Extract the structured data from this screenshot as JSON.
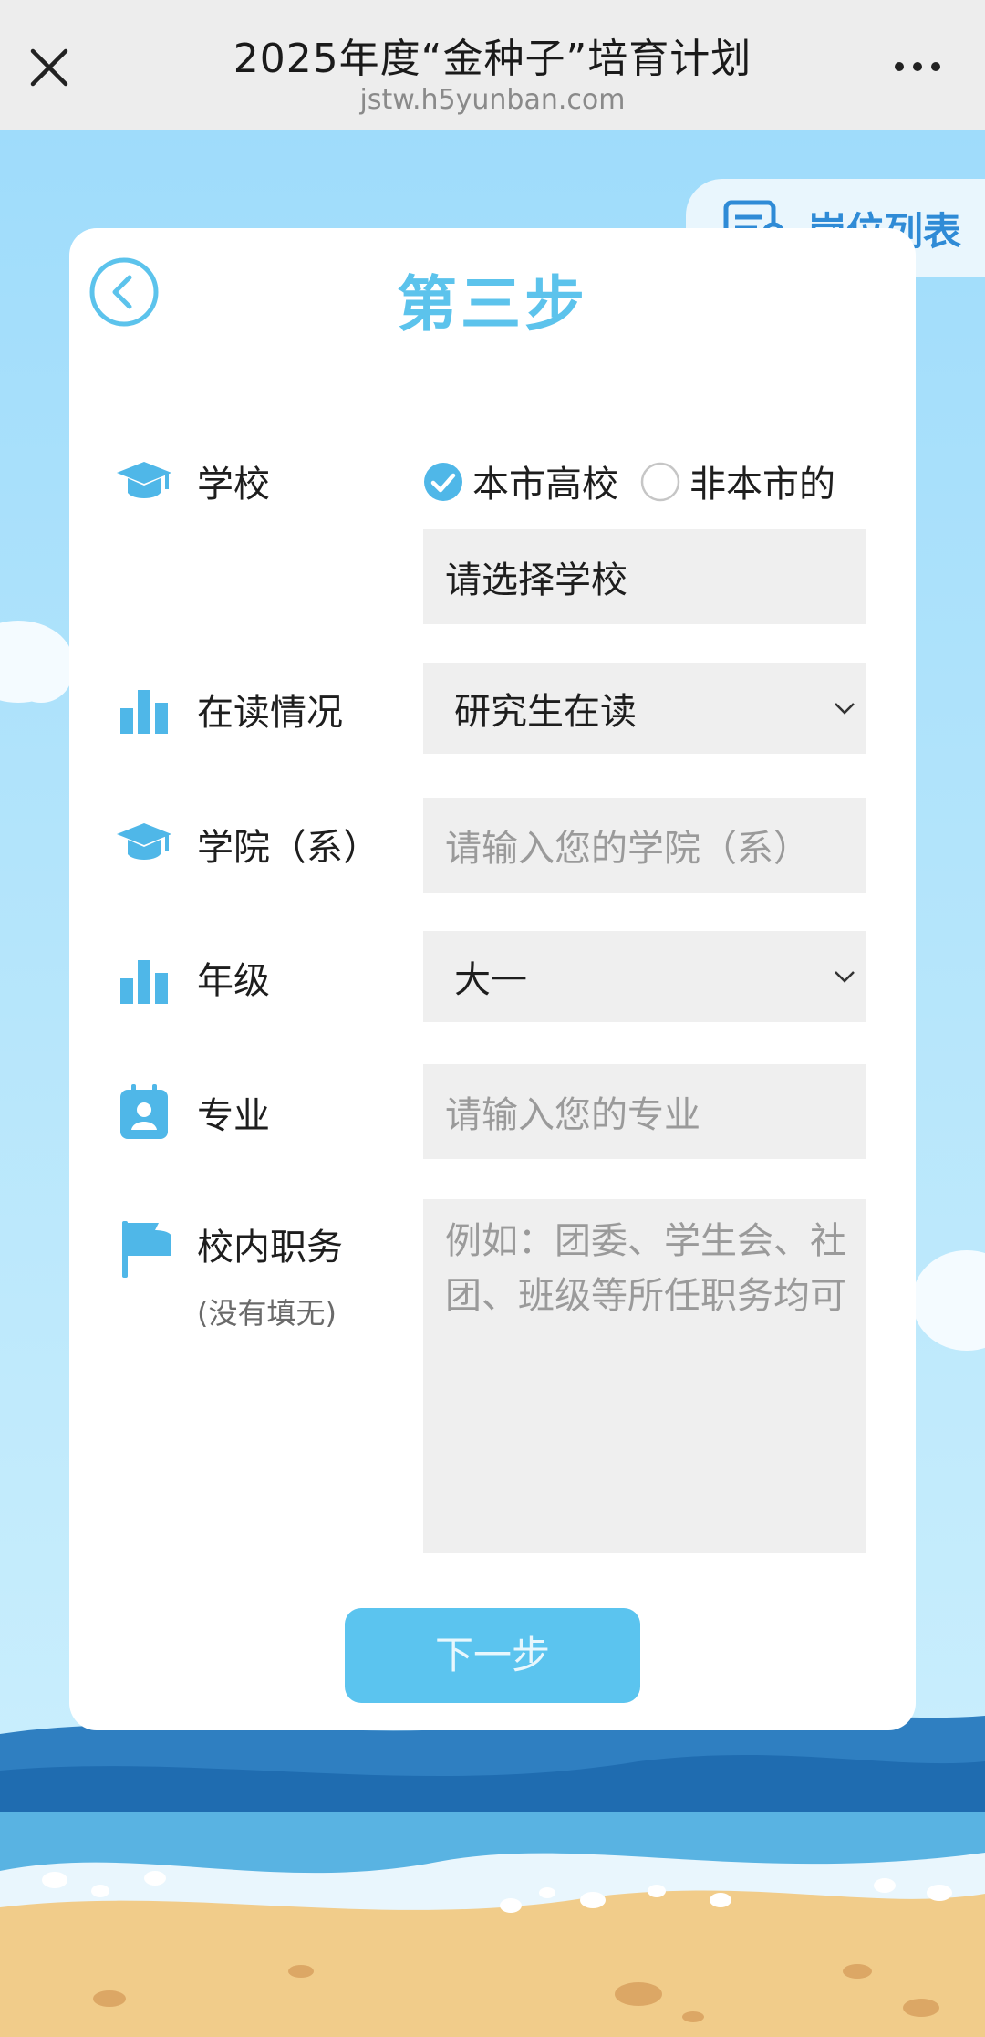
{
  "header": {
    "title": "2025年度“金种子”培育计划",
    "url": "jstw.h5yunban.com"
  },
  "job_tab": {
    "label": "岗位列表"
  },
  "form": {
    "step_title": "第三步",
    "school": {
      "label": "学校",
      "options": [
        "本市高校",
        "非本市的"
      ],
      "selected": "本市高校",
      "select_placeholder": "请选择学校"
    },
    "study_status": {
      "label": "在读情况",
      "value": "研究生在读"
    },
    "college": {
      "label": "学院（系）",
      "placeholder": "请输入您的学院（系）"
    },
    "grade": {
      "label": "年级",
      "value": "大一"
    },
    "major": {
      "label": "专业",
      "placeholder": "请输入您的专业"
    },
    "position": {
      "label": "校内职务",
      "sublabel": "(没有填无)",
      "placeholder": "例如：团委、学生会、社团、班级等所任职务均可"
    },
    "next_button": "下一步"
  },
  "colors": {
    "accent": "#5cc3ec",
    "icon_blue": "#4fb7e8",
    "job_tab_text": "#2f8bd6",
    "field_bg": "#efefef"
  },
  "icons": [
    "close-icon",
    "more-icon",
    "job-list-icon",
    "back-arrow-icon",
    "graduation-cap-icon",
    "bar-chart-icon",
    "id-card-icon",
    "flag-icon",
    "chevron-down-icon",
    "radio-checked-icon",
    "radio-unchecked-icon"
  ]
}
